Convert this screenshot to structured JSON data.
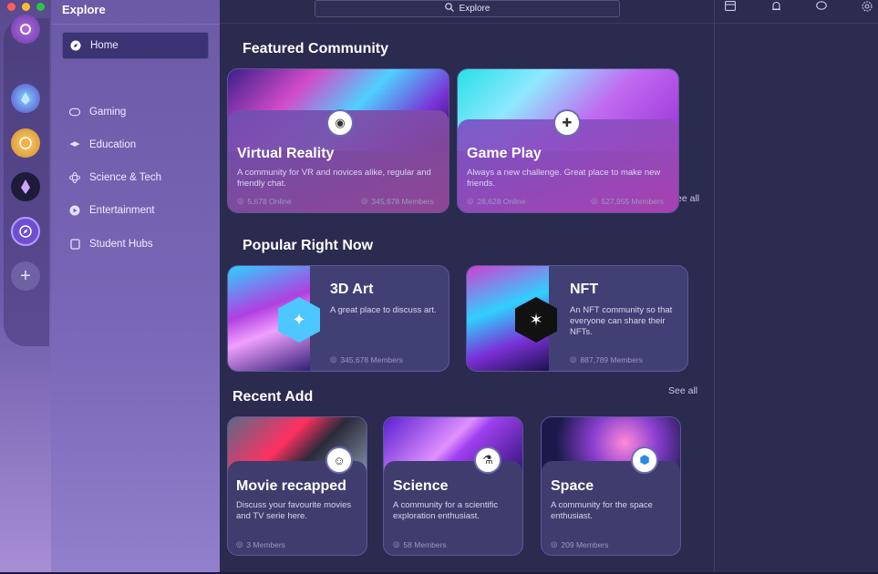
{
  "sidebar": {
    "title": "Explore",
    "items": [
      {
        "label": "Home",
        "icon": "compass-icon"
      },
      {
        "label": "Gaming",
        "icon": "gamepad-icon"
      },
      {
        "label": "Education",
        "icon": "graduation-cap-icon"
      },
      {
        "label": "Science & Tech",
        "icon": "atom-icon"
      },
      {
        "label": "Entertainment",
        "icon": "play-icon"
      },
      {
        "label": "Student Hubs",
        "icon": "hub-icon"
      }
    ]
  },
  "search": {
    "label": "Explore"
  },
  "sections": {
    "featured": {
      "title": "Featured Community",
      "see_all": "See all"
    },
    "popular": {
      "title": "Popular Right Now"
    },
    "recent": {
      "title": "Recent Add",
      "see_all": "See all"
    }
  },
  "featured_cards": [
    {
      "title": "Virtual Reality",
      "desc": "A community for VR and novices alike, regular and friendly chat.",
      "online": "5,678 Online",
      "members": "345,678 Members"
    },
    {
      "title": "Game Play",
      "desc": "Always a new challenge. Great place to make new friends.",
      "online": "28,628 Online",
      "members": "527,955 Members"
    }
  ],
  "popular_cards": [
    {
      "title": "3D Art",
      "desc": "A great place to discuss art.",
      "members": "345,678 Members"
    },
    {
      "title": "NFT",
      "desc": "An NFT community so that everyone can share their NFTs.",
      "members": "887,789 Members"
    }
  ],
  "recent_cards": [
    {
      "title": "Movie recapped",
      "desc": "Discuss your favourite movies and TV serie here.",
      "members": "3 Members"
    },
    {
      "title": "Science",
      "desc": "A community for a scientific exploration enthusiast.",
      "members": "58 Members"
    },
    {
      "title": "Space",
      "desc": "A community for the space enthusiast.",
      "members": "209 Members"
    }
  ],
  "colors": {
    "accent": "#7b6cf6",
    "background": "#2b2a4f",
    "sidebar": "#7a68b8"
  }
}
